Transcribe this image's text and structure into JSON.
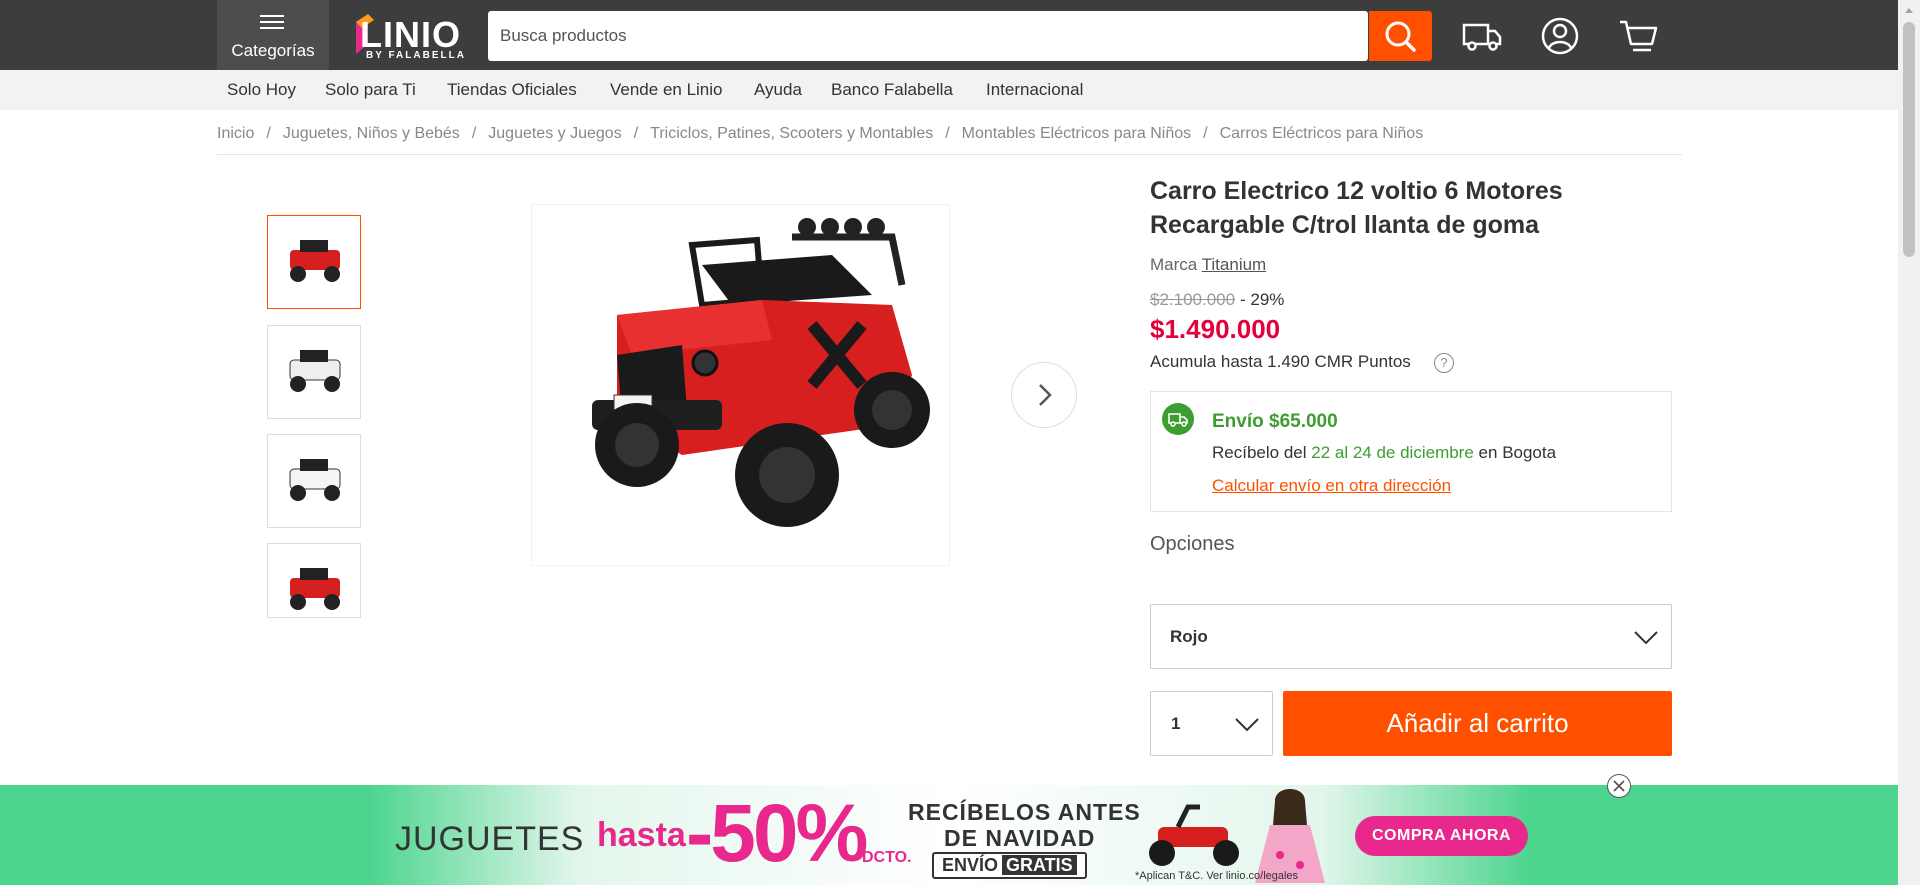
{
  "header": {
    "categories_label": "Categorías",
    "logo_word": "LINIO",
    "logo_sub": "BY FALABELLA",
    "search_placeholder": "Busca productos",
    "icons": [
      "search-icon",
      "truck-icon",
      "user-icon",
      "cart-icon"
    ],
    "accent_color": "#ff5000"
  },
  "nav": {
    "items": [
      "Solo Hoy",
      "Solo para Ti",
      "Tiendas Oficiales",
      "Vende en Linio",
      "Ayuda",
      "Banco Falabella",
      "Internacional"
    ]
  },
  "breadcrumb": {
    "items": [
      "Inicio",
      "Juguetes, Niños y Bebés",
      "Juguetes y Juegos",
      "Triciclos, Patines, Scooters y Montables",
      "Montables Eléctricos para Niños",
      "Carros Eléctricos para Niños"
    ],
    "separator": "/"
  },
  "product": {
    "title": "Carro Electrico 12 voltio 6 Motores Recargable C/trol llanta de goma",
    "brand_label": "Marca",
    "brand": "Titanium",
    "old_price": "$2.100.000",
    "discount": "- 29%",
    "price": "$1.490.000",
    "points": "Acumula hasta 1.490 CMR Puntos",
    "help": "?",
    "thumbnails": [
      "red",
      "white",
      "white",
      "red"
    ],
    "selected_thumbnail": 0
  },
  "shipping": {
    "title": "Envío $65.000",
    "receive_prefix": "Recíbelo del",
    "dates": "22 al 24 de diciembre",
    "city_prefix": "en",
    "city": "Bogota",
    "link": "Calcular envío en otra dirección"
  },
  "options": {
    "label": "Opciones",
    "color_value": "Rojo",
    "quantity": "1",
    "add_to_cart": "Añadir al carrito"
  },
  "banner": {
    "juguetes": "JUGUETES",
    "hasta": "hasta",
    "percent": "-50%",
    "dcto": "DCTO.",
    "line1": "RECÍBELOS ANTES",
    "line2": "DE NAVIDAD",
    "envio": "ENVÍO",
    "gratis": "GRATIS",
    "legal": "*Aplican T&C. Ver linio.co/legales",
    "cta": "COMPRA AHORA"
  }
}
